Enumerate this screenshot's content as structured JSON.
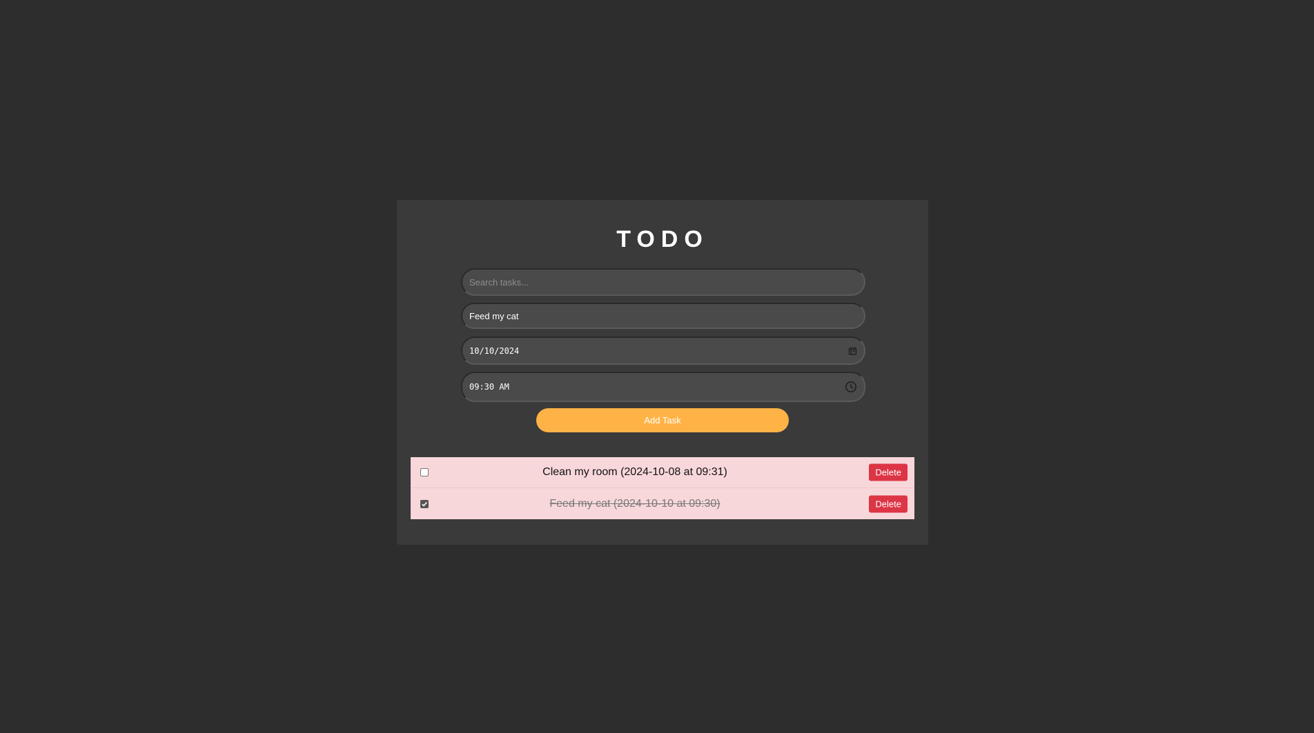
{
  "app": {
    "title": "TODO"
  },
  "form": {
    "search_placeholder": "Search tasks...",
    "task_value": "Feed my cat",
    "date_value": "10/10/2024",
    "time_value": "09:30 AM",
    "add_label": "Add Task"
  },
  "tasks": [
    {
      "text": "Clean my room (2024-10-08 at 09:31)",
      "completed": false,
      "delete_label": "Delete"
    },
    {
      "text": "Feed my cat (2024-10-10 at 09:30)",
      "completed": true,
      "delete_label": "Delete"
    }
  ],
  "icons": {
    "date": "calendar-icon",
    "time": "clock-icon",
    "checked": "checkmark-icon"
  },
  "colors": {
    "background": "#2d2d2d",
    "card": "#3a3a3a",
    "accent": "#ffb347",
    "task_bg": "#f8d7da",
    "delete": "#dc3545"
  }
}
